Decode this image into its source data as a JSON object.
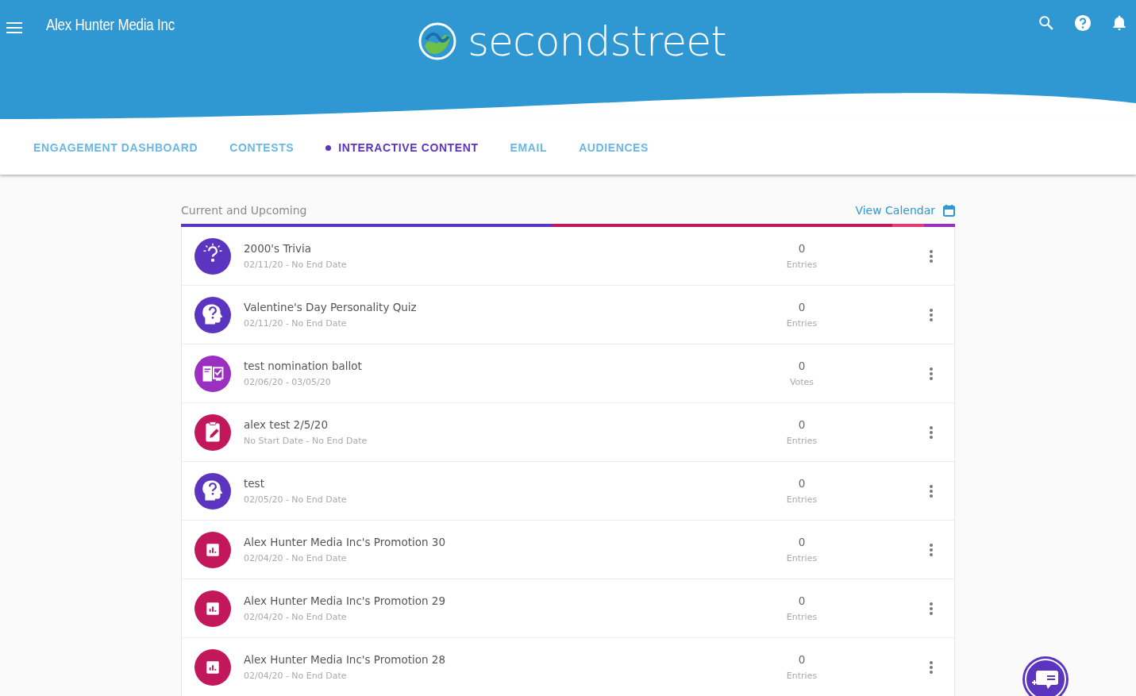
{
  "header": {
    "account": "Alex Hunter Media Inc",
    "logo_text": "secondstreet"
  },
  "tabs": [
    {
      "label": "ENGAGEMENT DASHBOARD",
      "selected": false
    },
    {
      "label": "CONTESTS",
      "selected": false
    },
    {
      "label": "INTERACTIVE CONTENT",
      "selected": true
    },
    {
      "label": "EMAIL",
      "selected": false
    },
    {
      "label": "AUDIENCES",
      "selected": false
    }
  ],
  "section": {
    "title": "Current and Upcoming",
    "calendar_link": "View Calendar"
  },
  "items": [
    {
      "kind": "trivia",
      "color": "#5b35c0",
      "title": "2000's Trivia",
      "dates": "02/11/20 - No End Date",
      "count": "0",
      "count_label": "Entries"
    },
    {
      "kind": "personality",
      "color": "#5b35c0",
      "title": "Valentine's Day Personality Quiz",
      "dates": "02/11/20 - No End Date",
      "count": "0",
      "count_label": "Entries"
    },
    {
      "kind": "ballot",
      "color": "#9a2fc0",
      "title": "test nomination ballot",
      "dates": "02/06/20 - 03/05/20",
      "count": "0",
      "count_label": "Votes"
    },
    {
      "kind": "survey",
      "color": "#c2185b",
      "title": "alex test 2/5/20",
      "dates": "No Start Date - No End Date",
      "count": "0",
      "count_label": "Entries"
    },
    {
      "kind": "personality",
      "color": "#5b35c0",
      "title": "test",
      "dates": "02/05/20 - No End Date",
      "count": "0",
      "count_label": "Entries"
    },
    {
      "kind": "poll",
      "color": "#c2185b",
      "title": "Alex Hunter Media Inc's Promotion 30",
      "dates": "02/04/20 - No End Date",
      "count": "0",
      "count_label": "Entries"
    },
    {
      "kind": "poll",
      "color": "#c2185b",
      "title": "Alex Hunter Media Inc's Promotion 29",
      "dates": "02/04/20 - No End Date",
      "count": "0",
      "count_label": "Entries"
    },
    {
      "kind": "poll",
      "color": "#c2185b",
      "title": "Alex Hunter Media Inc's Promotion 28",
      "dates": "02/04/20 - No End Date",
      "count": "0",
      "count_label": "Entries"
    }
  ]
}
